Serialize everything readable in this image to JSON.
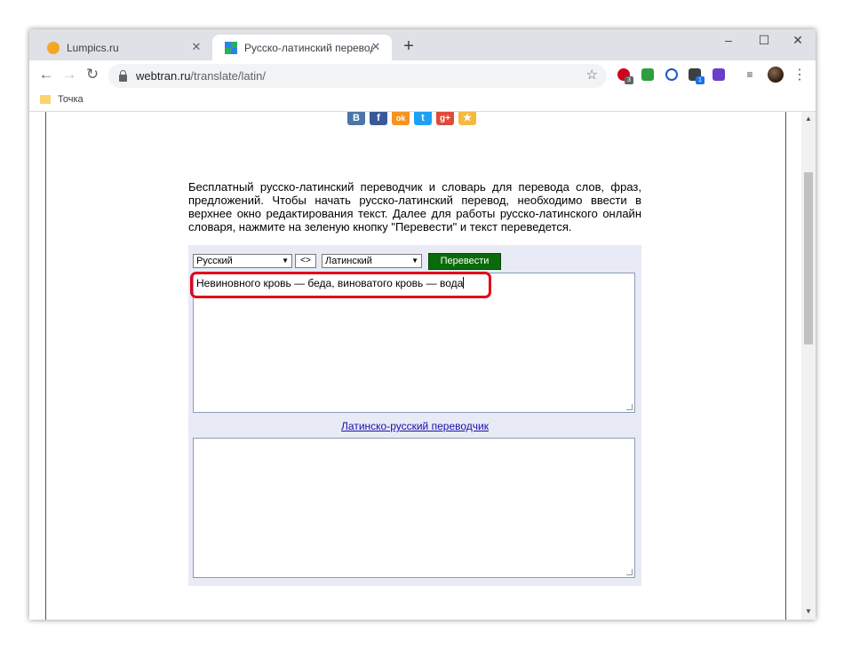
{
  "browser": {
    "tabs": [
      {
        "label": "Lumpics.ru",
        "close": "✕"
      },
      {
        "label": "Русско-латинский переводчик с",
        "close": "✕"
      }
    ],
    "new_tab": "+",
    "window_controls": {
      "minimize": "–",
      "maximize": "☐",
      "close": "✕"
    },
    "nav": {
      "back": "←",
      "forward": "→",
      "reload": "↻"
    },
    "url_host": "webtran.ru",
    "url_path": "/translate/latin/",
    "star": "☆",
    "extension_badges": {
      "opera_count": "3",
      "box_count": "1"
    },
    "menu": "⋮"
  },
  "bookmarks": [
    {
      "label": "Точка"
    }
  ],
  "page": {
    "social_buttons": [
      "B",
      "f",
      "ok",
      "t",
      "g+",
      "★"
    ],
    "description": "Бесплатный русско-латинский переводчик и словарь для перевода слов, фраз, предложений. Чтобы начать русско-латинский перевод, необходимо ввести в верхнее окно редактирования текст. Далее для работы русско-латинского онлайн словаря, нажмите на зеленую кнопку \"Перевести\" и текст переведется.",
    "translator": {
      "source_lang": "Русский",
      "swap_label": "<>",
      "target_lang": "Латинский",
      "translate_button": "Перевести",
      "source_text": "Невиновного кровь — беда, виноватого кровь — вода",
      "result_text": "",
      "reverse_link": "Латинско-русский переводчик"
    }
  },
  "colors": {
    "highlight": "#e0001a",
    "translate_button": "#0a6b0a",
    "panel": "#e8ebf5"
  }
}
